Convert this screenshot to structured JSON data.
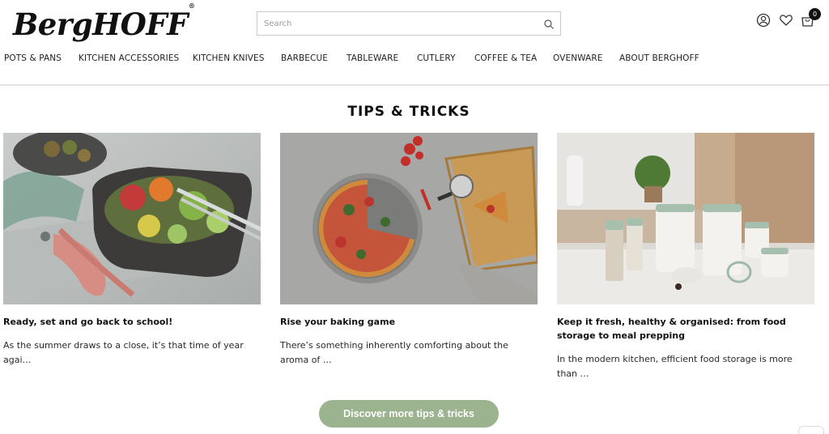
{
  "header": {
    "logo": "BergHOFF",
    "logo_mark": "®",
    "search_placeholder": "Search",
    "cart_count": "0",
    "icons": [
      "search-icon",
      "account-icon",
      "heart-icon",
      "cart-icon"
    ]
  },
  "nav": {
    "items": [
      "POTS & PANS",
      "KITCHEN ACCESSORIES",
      "KITCHEN KNIVES",
      "BARBECUE",
      "TABLEWARE",
      "CUTLERY",
      "COFFEE & TEA",
      "OVENWARE",
      "ABOUT BERGHOFF"
    ]
  },
  "section": {
    "title": "TIPS & TRICKS"
  },
  "cards": [
    {
      "title": "Ready, set and go back to school!",
      "excerpt": "As the summer draws to a close, it’s that time of year agai…"
    },
    {
      "title": "Rise your baking game",
      "excerpt": "There’s something inherently comforting about the aroma of …"
    },
    {
      "title": "Keep it fresh, healthy & organised: from food storage to meal prepping",
      "excerpt": "In the modern kitchen, efficient food storage is more than …"
    }
  ],
  "cta": {
    "label": "Discover more tips & tricks"
  },
  "colors": {
    "accent_green": "#9cb38f",
    "text": "#111111",
    "badge": "#111111"
  }
}
